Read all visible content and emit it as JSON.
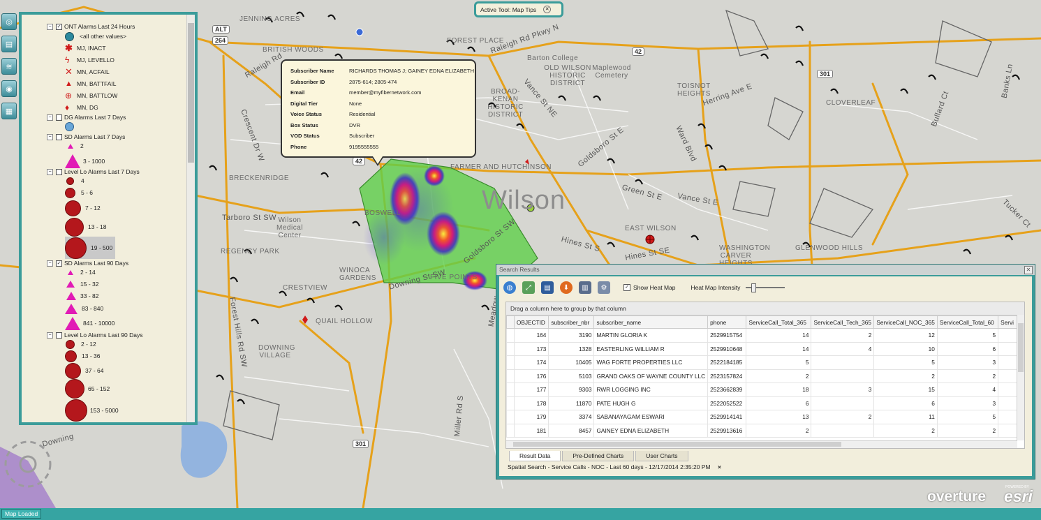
{
  "active_tool": {
    "label": "Active Tool:",
    "value": "Map Tips"
  },
  "legend": {
    "groups": [
      {
        "title": "ONT Alarms Last 24 Hours",
        "checked": true,
        "items": [
          "<all other values>",
          "MJ, INACT",
          "MJ, LEVELLO",
          "MN, ACFAIL",
          "MN, BATTFAIL",
          "MN, BATTLOW",
          "MN, DG"
        ]
      },
      {
        "title": "DG Alarms Last 7 Days",
        "checked": false,
        "items": []
      },
      {
        "title": "SD Alarms Last 7 Days",
        "checked": false,
        "items": [
          "2",
          "3 - 1000"
        ]
      },
      {
        "title": "Level Lo Alarms Last 7 Days",
        "checked": false,
        "items": [
          "4",
          "5 - 6",
          "7 - 12",
          "13 - 18",
          "19 - 500"
        ]
      },
      {
        "title": "SD Alarms Last 90 Days",
        "checked": true,
        "items": [
          "2 - 14",
          "15 - 32",
          "33 - 82",
          "83 - 840",
          "841 - 10000"
        ]
      },
      {
        "title": "Level Lo Alarms Last 90 Days",
        "checked": false,
        "items": [
          "2 - 12",
          "13 - 36",
          "37 - 64",
          "65 - 152",
          "153 - 5000"
        ]
      }
    ]
  },
  "map_labels": {
    "city": "Wilson",
    "places": [
      "JENNING ACRES",
      "BRITISH WOODS",
      "FOREST PLACE",
      "Barton College",
      "OLD WILSON HISTORIC DISTRICT",
      "Maplewood Cemetery",
      "BROAD-KENAN HISTORIC DISTRICT",
      "TOISNOT HEIGHTS",
      "CLOVERLEAF",
      "BRECKENRIDGE",
      "FARMER AND HUTCHINSON",
      "Wilson Medical Center",
      "REGENCY PARK",
      "EAST WILSON",
      "GLENWOOD HILLS",
      "WINOCA GARDENS",
      "CRESTVIEW",
      "QUAIL HOLLOW",
      "DOWNING VILLAGE",
      "FIVE POINTS",
      "BOSWELL",
      "WASHINGTON CARVER HEIGHTS"
    ],
    "streets": [
      "Raleigh Rd",
      "Tarboro St SW",
      "Goldsboro St SW",
      "Goldsboro St E",
      "Vance St NE",
      "Green St E",
      "Hines St S",
      "Hines St SE",
      "Ward Blvd",
      "Forest Hills Rd SW",
      "Miller Rd S",
      "Meadow",
      "Downing St SW",
      "Tucker Ct",
      "Bullard Ct",
      "Banks Ln",
      "Downing",
      "Crescent Dr W",
      "Vance St E",
      "Raleigh Rd Pkwy N",
      "Herring Ave E"
    ],
    "shields": [
      "42",
      "301",
      "264",
      "ALT",
      "42",
      "301"
    ]
  },
  "popup": {
    "rows": [
      {
        "key": "Subscriber Name",
        "value": "RICHARDS THOMAS J; GAINEY EDNA ELIZABETH"
      },
      {
        "key": "Subscriber ID",
        "value": "2875-614; 2805-474"
      },
      {
        "key": "Email",
        "value": "member@myfibernetwork.com"
      },
      {
        "key": "Digital Tier",
        "value": "None"
      },
      {
        "key": "Voice Status",
        "value": "Residential"
      },
      {
        "key": "Box Status",
        "value": "DVR"
      },
      {
        "key": "VOD Status",
        "value": "Subscriber"
      },
      {
        "key": "Phone",
        "value": "9195555555"
      }
    ]
  },
  "search_results": {
    "title": "Search Results",
    "show_heat_map_label": "Show Heat Map",
    "show_heat_map_checked": true,
    "heat_map_intensity_label": "Heat Map Intensity",
    "heat_map_intensity": 0.15,
    "group_hint": "Drag a column here to group by that column",
    "columns": [
      "OBJECTID",
      "subscriber_nbr",
      "subscriber_name",
      "phone",
      "ServiceCall_Total_365",
      "ServiceCall_Tech_365",
      "ServiceCall_NOC_365",
      "ServiceCall_Total_60",
      "Servi"
    ],
    "rows": [
      [
        "164",
        "3190",
        "MARTIN GLORIA K",
        "2529915754",
        "14",
        "2",
        "12",
        "5",
        ""
      ],
      [
        "173",
        "1328",
        "EASTERLING WILLIAM R",
        "2529910648",
        "14",
        "4",
        "10",
        "6",
        ""
      ],
      [
        "174",
        "10405",
        "WAG FORTE PROPERTIES LLC",
        "2522184185",
        "5",
        "",
        "5",
        "3",
        ""
      ],
      [
        "176",
        "5103",
        "GRAND OAKS OF WAYNE COUNTY LLC",
        "2523157824",
        "2",
        "",
        "2",
        "2",
        ""
      ],
      [
        "177",
        "9303",
        "RWR LOGGING INC",
        "2523662839",
        "18",
        "3",
        "15",
        "4",
        ""
      ],
      [
        "178",
        "11870",
        "PATE HUGH G",
        "2522052522",
        "6",
        "",
        "6",
        "3",
        ""
      ],
      [
        "179",
        "3374",
        "SABANAYAGAM ESWARI",
        "2529914141",
        "13",
        "2",
        "11",
        "5",
        ""
      ],
      [
        "181",
        "8457",
        "GAINEY EDNA ELIZABETH",
        "2529913616",
        "2",
        "",
        "2",
        "2",
        ""
      ]
    ],
    "tabs": [
      "Result Data",
      "Pre-Defined Charts",
      "User Charts"
    ],
    "active_tab": "Result Data",
    "search_tab_label": "Spatial Search - Service Calls - NOC - Last 60 days - 12/17/2014 2:35:20 PM",
    "search_tab_close": "×"
  },
  "status": {
    "message": "Map Loaded"
  },
  "branding": {
    "product": "overture",
    "powered_by": "POWERED BY",
    "esri": "esri"
  },
  "colors": {
    "accent": "#3b9c9a",
    "polygon": "#5fd04a",
    "roads": "#e6a11a",
    "alarm_red": "#b4171c",
    "sd_magenta": "#e11bb5"
  }
}
